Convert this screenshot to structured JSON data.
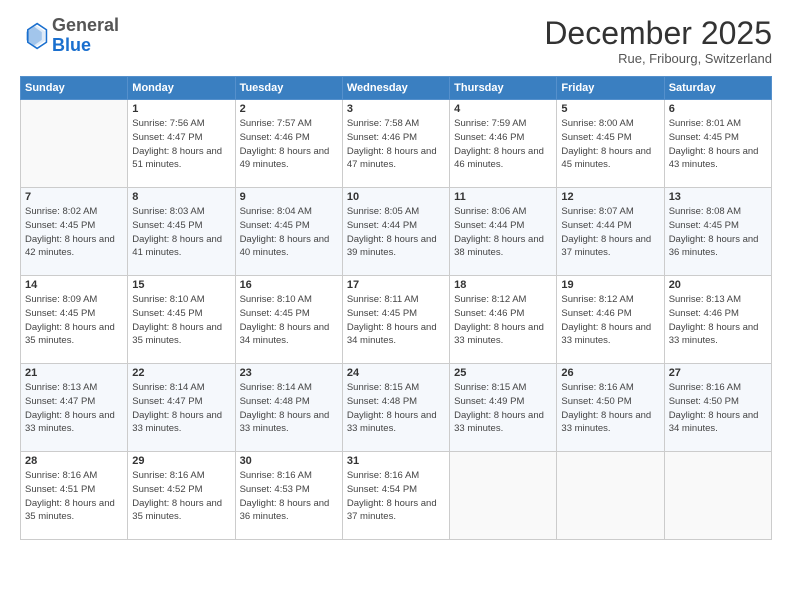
{
  "header": {
    "logo_general": "General",
    "logo_blue": "Blue",
    "month_title": "December 2025",
    "location": "Rue, Fribourg, Switzerland"
  },
  "columns": [
    "Sunday",
    "Monday",
    "Tuesday",
    "Wednesday",
    "Thursday",
    "Friday",
    "Saturday"
  ],
  "weeks": [
    [
      {
        "day": "",
        "sunrise": "",
        "sunset": "",
        "daylight": ""
      },
      {
        "day": "1",
        "sunrise": "7:56 AM",
        "sunset": "4:47 PM",
        "daylight": "8 hours and 51 minutes."
      },
      {
        "day": "2",
        "sunrise": "7:57 AM",
        "sunset": "4:46 PM",
        "daylight": "8 hours and 49 minutes."
      },
      {
        "day": "3",
        "sunrise": "7:58 AM",
        "sunset": "4:46 PM",
        "daylight": "8 hours and 47 minutes."
      },
      {
        "day": "4",
        "sunrise": "7:59 AM",
        "sunset": "4:46 PM",
        "daylight": "8 hours and 46 minutes."
      },
      {
        "day": "5",
        "sunrise": "8:00 AM",
        "sunset": "4:45 PM",
        "daylight": "8 hours and 45 minutes."
      },
      {
        "day": "6",
        "sunrise": "8:01 AM",
        "sunset": "4:45 PM",
        "daylight": "8 hours and 43 minutes."
      }
    ],
    [
      {
        "day": "7",
        "sunrise": "8:02 AM",
        "sunset": "4:45 PM",
        "daylight": "8 hours and 42 minutes."
      },
      {
        "day": "8",
        "sunrise": "8:03 AM",
        "sunset": "4:45 PM",
        "daylight": "8 hours and 41 minutes."
      },
      {
        "day": "9",
        "sunrise": "8:04 AM",
        "sunset": "4:45 PM",
        "daylight": "8 hours and 40 minutes."
      },
      {
        "day": "10",
        "sunrise": "8:05 AM",
        "sunset": "4:44 PM",
        "daylight": "8 hours and 39 minutes."
      },
      {
        "day": "11",
        "sunrise": "8:06 AM",
        "sunset": "4:44 PM",
        "daylight": "8 hours and 38 minutes."
      },
      {
        "day": "12",
        "sunrise": "8:07 AM",
        "sunset": "4:44 PM",
        "daylight": "8 hours and 37 minutes."
      },
      {
        "day": "13",
        "sunrise": "8:08 AM",
        "sunset": "4:45 PM",
        "daylight": "8 hours and 36 minutes."
      }
    ],
    [
      {
        "day": "14",
        "sunrise": "8:09 AM",
        "sunset": "4:45 PM",
        "daylight": "8 hours and 35 minutes."
      },
      {
        "day": "15",
        "sunrise": "8:10 AM",
        "sunset": "4:45 PM",
        "daylight": "8 hours and 35 minutes."
      },
      {
        "day": "16",
        "sunrise": "8:10 AM",
        "sunset": "4:45 PM",
        "daylight": "8 hours and 34 minutes."
      },
      {
        "day": "17",
        "sunrise": "8:11 AM",
        "sunset": "4:45 PM",
        "daylight": "8 hours and 34 minutes."
      },
      {
        "day": "18",
        "sunrise": "8:12 AM",
        "sunset": "4:46 PM",
        "daylight": "8 hours and 33 minutes."
      },
      {
        "day": "19",
        "sunrise": "8:12 AM",
        "sunset": "4:46 PM",
        "daylight": "8 hours and 33 minutes."
      },
      {
        "day": "20",
        "sunrise": "8:13 AM",
        "sunset": "4:46 PM",
        "daylight": "8 hours and 33 minutes."
      }
    ],
    [
      {
        "day": "21",
        "sunrise": "8:13 AM",
        "sunset": "4:47 PM",
        "daylight": "8 hours and 33 minutes."
      },
      {
        "day": "22",
        "sunrise": "8:14 AM",
        "sunset": "4:47 PM",
        "daylight": "8 hours and 33 minutes."
      },
      {
        "day": "23",
        "sunrise": "8:14 AM",
        "sunset": "4:48 PM",
        "daylight": "8 hours and 33 minutes."
      },
      {
        "day": "24",
        "sunrise": "8:15 AM",
        "sunset": "4:48 PM",
        "daylight": "8 hours and 33 minutes."
      },
      {
        "day": "25",
        "sunrise": "8:15 AM",
        "sunset": "4:49 PM",
        "daylight": "8 hours and 33 minutes."
      },
      {
        "day": "26",
        "sunrise": "8:16 AM",
        "sunset": "4:50 PM",
        "daylight": "8 hours and 33 minutes."
      },
      {
        "day": "27",
        "sunrise": "8:16 AM",
        "sunset": "4:50 PM",
        "daylight": "8 hours and 34 minutes."
      }
    ],
    [
      {
        "day": "28",
        "sunrise": "8:16 AM",
        "sunset": "4:51 PM",
        "daylight": "8 hours and 35 minutes."
      },
      {
        "day": "29",
        "sunrise": "8:16 AM",
        "sunset": "4:52 PM",
        "daylight": "8 hours and 35 minutes."
      },
      {
        "day": "30",
        "sunrise": "8:16 AM",
        "sunset": "4:53 PM",
        "daylight": "8 hours and 36 minutes."
      },
      {
        "day": "31",
        "sunrise": "8:16 AM",
        "sunset": "4:54 PM",
        "daylight": "8 hours and 37 minutes."
      },
      {
        "day": "",
        "sunrise": "",
        "sunset": "",
        "daylight": ""
      },
      {
        "day": "",
        "sunrise": "",
        "sunset": "",
        "daylight": ""
      },
      {
        "day": "",
        "sunrise": "",
        "sunset": "",
        "daylight": ""
      }
    ]
  ]
}
